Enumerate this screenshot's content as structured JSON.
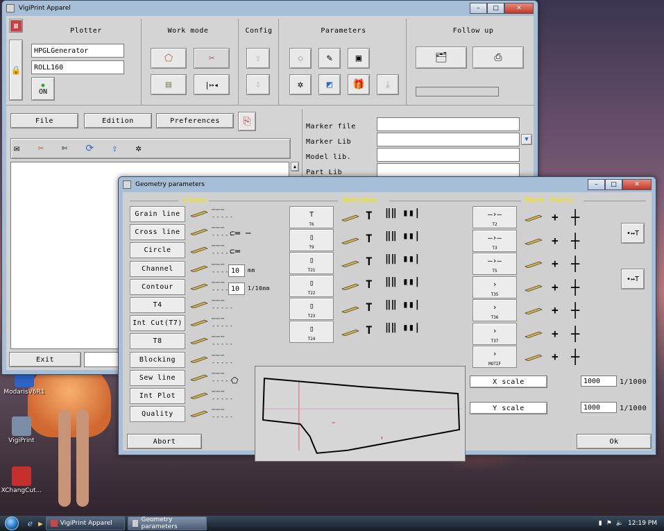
{
  "desktop": {
    "icons": [
      {
        "label": "ModarisV6R1",
        "color": "#2c63c4"
      },
      {
        "label": "VigiPrint",
        "color": "#7a8ea8"
      },
      {
        "label": "XChangCut...",
        "color": "#c4302c"
      }
    ]
  },
  "main_window": {
    "title": "VigiPrint Apparel",
    "sections": {
      "plotter": "Plotter",
      "work_mode": "Work mode",
      "config": "Config",
      "parameters": "Parameters",
      "follow_up": "Follow up"
    },
    "plotter_driver": "HPGLGenerator",
    "plotter_media": "ROLL160",
    "on_label": "ON",
    "menu": {
      "file": "File",
      "edition": "Edition",
      "preferences": "Preferences"
    },
    "fields": {
      "marker_file": "Marker file",
      "marker_lib": "Marker Lib",
      "model_lib": "Model lib.",
      "part_lib": "Part Lib"
    },
    "exit": "Exit"
  },
  "geometry_window": {
    "title": "Geometry parameters",
    "headers": {
      "lines": "Lines",
      "notches": "Notches",
      "mark_tools": "Mark Tools"
    },
    "line_items": [
      "Grain line",
      "Cross line",
      "Circle",
      "Channel",
      "Contour",
      "T4",
      "Int Cut(T7)",
      "T8",
      "Blocking",
      "Sew line",
      "Int Plot",
      "Quality"
    ],
    "circle_value": "10",
    "circle_unit": "mm",
    "channel_value": "10",
    "channel_unit": "1/10mm",
    "notch_tools": [
      "T6",
      "T9",
      "T21",
      "T22",
      "T23",
      "T24"
    ],
    "mark_tools": [
      "T2",
      "T3",
      "T5",
      "T35",
      "T36",
      "T37",
      "MOTIF"
    ],
    "x_scale_label": "X scale",
    "x_scale_value": "1000",
    "x_scale_unit": "1/1000",
    "y_scale_label": "Y scale",
    "y_scale_value": "1000",
    "y_scale_unit": "1/1000",
    "abort": "Abort",
    "ok": "Ok"
  },
  "taskbar": {
    "items": [
      "VigiPrint Apparel",
      "Geometry parameters"
    ],
    "time": "12:19 PM"
  },
  "colors": {
    "desktop_accent": "#b4787c",
    "header_yellow": "#f2e400",
    "window_face": "#d4d4d4"
  }
}
